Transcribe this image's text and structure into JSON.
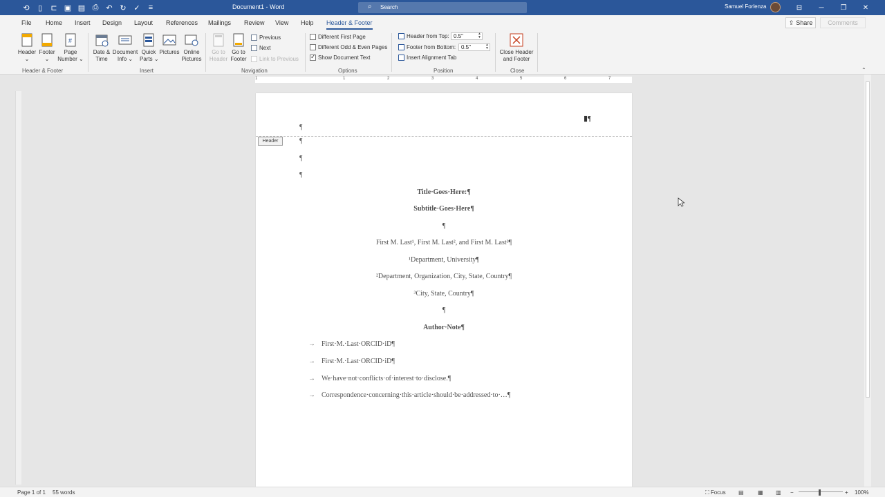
{
  "window": {
    "doc_title": "Document1 - Word",
    "search_label": "Search",
    "user_name": "Samuel Forlenza"
  },
  "qat_icons": [
    "autosave-icon",
    "new-doc-icon",
    "open-icon",
    "save-icon",
    "save-as-icon",
    "print-icon",
    "undo-icon",
    "redo-icon",
    "spelling-icon",
    "customize-icon"
  ],
  "tabs": [
    {
      "label": "File",
      "active": false
    },
    {
      "label": "Home",
      "active": false
    },
    {
      "label": "Insert",
      "active": false
    },
    {
      "label": "Design",
      "active": false
    },
    {
      "label": "Layout",
      "active": false
    },
    {
      "label": "References",
      "active": false
    },
    {
      "label": "Mailings",
      "active": false
    },
    {
      "label": "Review",
      "active": false
    },
    {
      "label": "View",
      "active": false
    },
    {
      "label": "Help",
      "active": false
    },
    {
      "label": "Header & Footer",
      "active": true
    }
  ],
  "share_label": "Share",
  "comments_label": "Comments",
  "ribbon": {
    "header_footer": {
      "header_l1": "Header",
      "footer_l1": "Footer",
      "page_number_l1": "Page",
      "page_number_l2": "Number",
      "group_label": "Header & Footer"
    },
    "insert": {
      "date_l1": "Date &",
      "date_l2": "Time",
      "docinfo_l1": "Document",
      "docinfo_l2": "Info",
      "quickparts_l1": "Quick",
      "quickparts_l2": "Parts",
      "pictures_l1": "Pictures",
      "online_l1": "Online",
      "online_l2": "Pictures",
      "group_label": "Insert"
    },
    "navigation": {
      "goto_header_l1": "Go to",
      "goto_header_l2": "Header",
      "goto_footer_l1": "Go to",
      "goto_footer_l2": "Footer",
      "previous": "Previous",
      "next": "Next",
      "link_previous": "Link to Previous",
      "group_label": "Navigation"
    },
    "options": {
      "diff_first": "Different First Page",
      "diff_odd_even": "Different Odd & Even Pages",
      "show_doc_text": "Show Document Text",
      "show_doc_text_checked": true,
      "group_label": "Options"
    },
    "position": {
      "header_from_top": "Header from Top:",
      "header_value": "0.5\"",
      "footer_from_bottom": "Footer from Bottom:",
      "footer_value": "0.5\"",
      "insert_alignment_tab": "Insert Alignment Tab",
      "group_label": "Position"
    },
    "close": {
      "close_l1": "Close Header",
      "close_l2": "and Footer",
      "group_label": "Close"
    }
  },
  "ruler_ticks": [
    "1",
    "1",
    "2",
    "3",
    "4",
    "5",
    "6",
    "7"
  ],
  "document": {
    "header_tag": "Header",
    "pilcrow": "¶",
    "header_mark": "▮¶",
    "title": "Title·Goes·Here:¶",
    "subtitle": "Subtitle·Goes·Here¶",
    "blank1": "¶",
    "authors": "First M. Last¹, First M. Last², and First M. Last³¶",
    "aff1": "¹Department, University¶",
    "aff2": "²Department, Organization, City, State, Country¶",
    "aff3": "³City, State, Country¶",
    "blank2": "¶",
    "author_note": "Author·Note¶",
    "bullets": [
      "First·M.·Last·ORCID·iD¶",
      "First·M.·Last·ORCID·iD¶",
      "We·have·not·conflicts·of·interest·to·disclose.¶",
      "Correspondence·concerning·this·article·should·be·addressed·to·…¶"
    ],
    "arrow": "→"
  },
  "status": {
    "page": "Page 1 of 1",
    "words": "55 words",
    "focus": "Focus",
    "zoom": "100%"
  }
}
